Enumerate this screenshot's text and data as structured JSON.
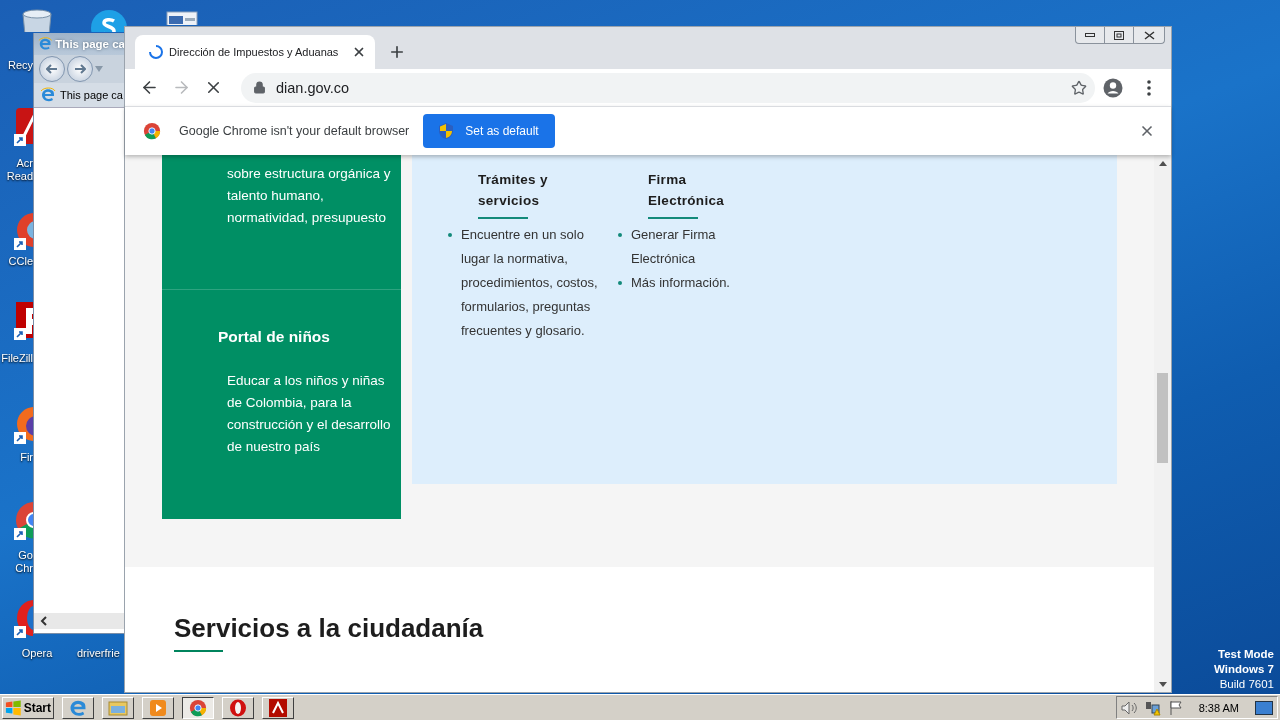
{
  "desktop": {
    "icons": [
      {
        "kind": "recycle",
        "lines": [
          "Recy"
        ]
      },
      {
        "kind": "acrobat",
        "lines": [
          "Acr",
          "Read"
        ]
      },
      {
        "kind": "ccleaner",
        "lines": [
          "CCle"
        ]
      },
      {
        "kind": "filezilla",
        "lines": [
          "FileZill"
        ]
      },
      {
        "kind": "firefox",
        "lines": [
          "Fir"
        ]
      },
      {
        "kind": "chrome",
        "lines": [
          "Go",
          "Chr"
        ]
      },
      {
        "kind": "opera",
        "lines": [
          "Opera"
        ]
      },
      {
        "kind": "hidden",
        "lines": [
          "driverfrie"
        ]
      },
      {
        "kind": "skype"
      },
      {
        "kind": "document"
      }
    ],
    "watermark": [
      "Test Mode",
      "Windows 7",
      "Build 7601"
    ]
  },
  "ie_window": {
    "title": "This page ca",
    "tab": "This page ca"
  },
  "chrome": {
    "tab": {
      "title": "Dirección de Impuestos y Aduanas",
      "loading": true
    },
    "toolbar": {
      "forward_enabled": false,
      "loading": true,
      "url": "dian.gov.co"
    },
    "infobar": {
      "message": "Google Chrome isn't your default browser",
      "button": "Set as default"
    },
    "page": {
      "green_cards": [
        {
          "lines": [
            "sobre estructura orgánica y",
            "talento humano,",
            "normatividad, presupuesto"
          ]
        },
        {
          "title": "Portal de niños",
          "lines": [
            "Educar a los niños y niñas",
            "de Colombia, para la",
            "construcción y el desarrollo",
            "de nuestro país"
          ]
        }
      ],
      "blue_columns": [
        {
          "title": [
            "Trámites y",
            "servicios"
          ],
          "items": [
            {
              "lines": [
                "Encuentre en un solo",
                "lugar la normativa,",
                "procedimientos, costos,",
                "formularios, preguntas",
                "frecuentes y glosario."
              ]
            }
          ]
        },
        {
          "title": [
            "Firma",
            "Electrónica"
          ],
          "items": [
            {
              "lines": [
                "Generar Firma",
                "Electrónica"
              ]
            },
            {
              "lines": [
                "Más información."
              ]
            }
          ]
        }
      ],
      "section_title": "Servicios a la ciudadanía"
    }
  },
  "taskbar": {
    "start": "Start",
    "buttons": [
      {
        "kind": "ie",
        "selected": false
      },
      {
        "kind": "explorer",
        "selected": false
      },
      {
        "kind": "media",
        "selected": false
      },
      {
        "kind": "chrome",
        "selected": true
      },
      {
        "kind": "opera",
        "selected": false
      },
      {
        "kind": "acrobat",
        "selected": false
      }
    ],
    "time": "8:38 AM"
  }
}
